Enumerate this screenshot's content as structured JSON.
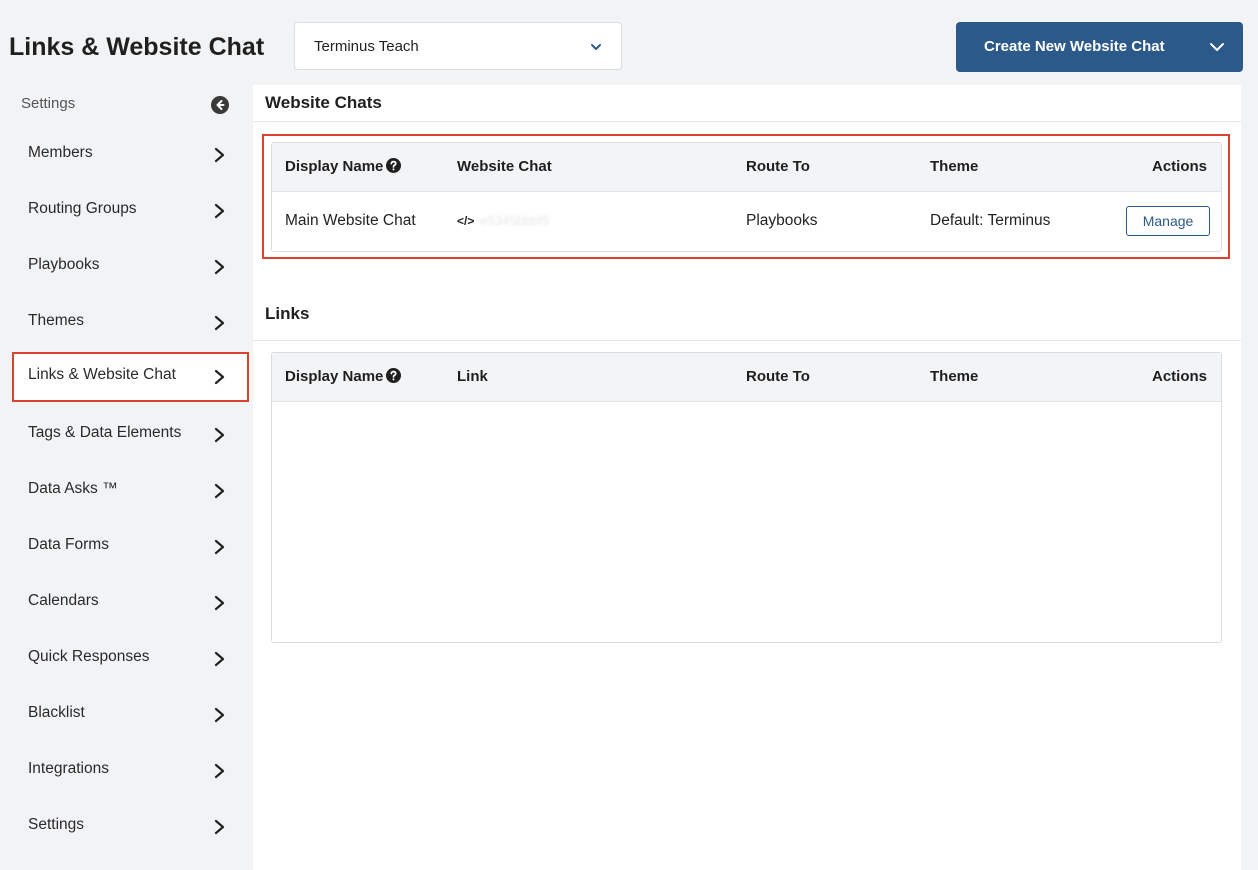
{
  "header": {
    "title": "Links & Website Chat",
    "account_select": {
      "value": "Terminus Teach"
    },
    "create_button": {
      "label": "Create New Website Chat"
    }
  },
  "sidebar": {
    "header_label": "Settings",
    "items": [
      {
        "label": "Members"
      },
      {
        "label": "Routing Groups"
      },
      {
        "label": "Playbooks"
      },
      {
        "label": "Themes"
      },
      {
        "label": "Links & Website Chat",
        "active": true
      },
      {
        "label": "Tags & Data Elements"
      },
      {
        "label": "Data Asks ™"
      },
      {
        "label": "Data Forms"
      },
      {
        "label": "Calendars"
      },
      {
        "label": "Quick Responses"
      },
      {
        "label": "Blacklist"
      },
      {
        "label": "Integrations"
      },
      {
        "label": "Settings"
      }
    ]
  },
  "website_chats": {
    "title": "Website Chats",
    "columns": [
      "Display Name",
      "Website Chat",
      "Route To",
      "Theme",
      "Actions"
    ],
    "rows": [
      {
        "display_name": "Main Website Chat",
        "code_icon": "</>",
        "website_chat_id": "e5345bbbf5",
        "route_to": "Playbooks",
        "theme": "Default: Terminus",
        "action": "Manage"
      }
    ]
  },
  "links": {
    "title": "Links",
    "columns": [
      "Display Name",
      "Link",
      "Route To",
      "Theme",
      "Actions"
    ],
    "rows": []
  },
  "colors": {
    "primary": "#2b5a8a",
    "highlight": "#d9442e",
    "background": "#f2f3f5"
  },
  "icons": {
    "account_chevron": "chevron-down-icon",
    "create_chevron": "chevron-down-icon",
    "sidebar_back": "back-circle-icon",
    "nav_arrow": "chevron-right-icon",
    "help": "help-circle-icon",
    "code": "code-icon"
  }
}
